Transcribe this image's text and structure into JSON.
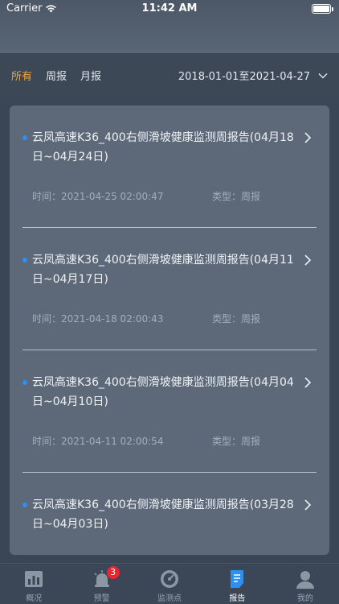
{
  "status": {
    "carrier": "Carrier",
    "time": "11:42 AM"
  },
  "filter": {
    "tabs": [
      {
        "label": "所有",
        "active": true
      },
      {
        "label": "周报",
        "active": false
      },
      {
        "label": "月报",
        "active": false
      }
    ],
    "date_range": "2018-01-01至2021-04-27"
  },
  "reports": [
    {
      "title": "云凤高速K36_400右侧滑坡健康监测周报告(04月18日~04月24日)",
      "time": "时间：2021-04-25 02:00:47",
      "type": "类型：周报"
    },
    {
      "title": "云凤高速K36_400右侧滑坡健康监测周报告(04月11日~04月17日)",
      "time": "时间：2021-04-18 02:00:43",
      "type": "类型：周报"
    },
    {
      "title": "云凤高速K36_400右侧滑坡健康监测周报告(04月04日~04月10日)",
      "time": "时间：2021-04-11 02:00:54",
      "type": "类型：周报"
    },
    {
      "title": "云凤高速K36_400右侧滑坡健康监测周报告(03月28日~04月03日)",
      "time": "",
      "type": ""
    }
  ],
  "tabbar": {
    "items": [
      {
        "label": "概况",
        "icon": "chart-icon",
        "active": false
      },
      {
        "label": "预警",
        "icon": "alarm-icon",
        "active": false,
        "badge": "3"
      },
      {
        "label": "监测点",
        "icon": "gauge-icon",
        "active": false
      },
      {
        "label": "报告",
        "icon": "report-icon",
        "active": true
      },
      {
        "label": "我的",
        "icon": "user-icon",
        "active": false
      }
    ]
  },
  "colors": {
    "accent": "#f0a63a",
    "bullet": "#2e8ff2",
    "badge": "#e8262d"
  }
}
